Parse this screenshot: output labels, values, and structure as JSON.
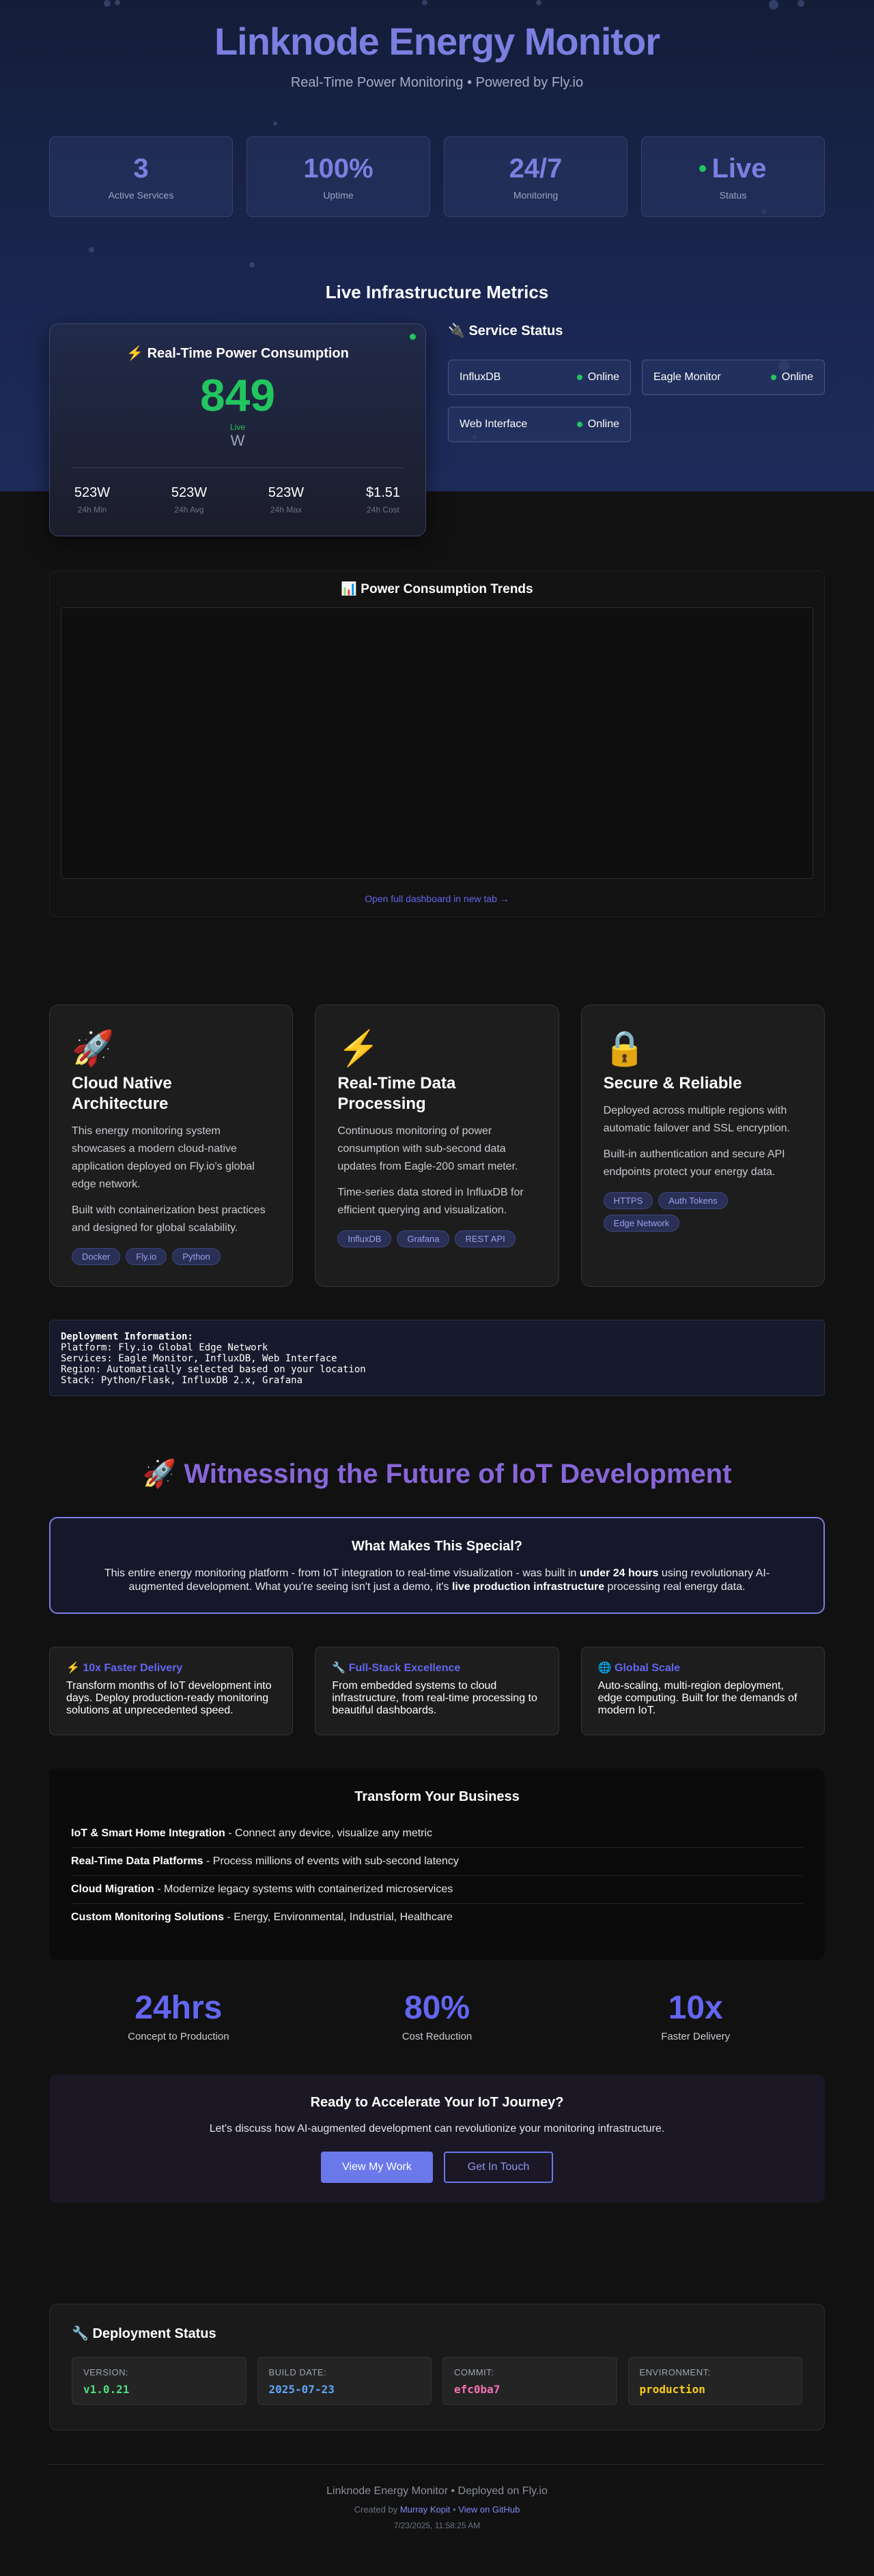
{
  "hero": {
    "title": "Linknode Energy Monitor",
    "subtitle": "Real-Time Power Monitoring • Powered by Fly.io",
    "stats": [
      {
        "value": "3",
        "label": "Active Services"
      },
      {
        "value": "100%",
        "label": "Uptime"
      },
      {
        "value": "24/7",
        "label": "Monitoring"
      },
      {
        "value": "Live",
        "label": "Status"
      }
    ]
  },
  "metrics": {
    "title": "Live Infrastructure Metrics",
    "power": {
      "title": "⚡ Real-Time Power Consumption",
      "value": "849",
      "live_label": "Live",
      "unit": "W",
      "stats": [
        {
          "value": "523W",
          "label": "24h Min"
        },
        {
          "value": "523W",
          "label": "24h Avg"
        },
        {
          "value": "523W",
          "label": "24h Max"
        },
        {
          "value": "$1.51",
          "label": "24h Cost"
        }
      ]
    },
    "services": {
      "title": "🔌 Service Status",
      "items": [
        {
          "name": "InfluxDB",
          "status": "Online"
        },
        {
          "name": "Eagle Monitor",
          "status": "Online"
        },
        {
          "name": "Web Interface",
          "status": "Online"
        }
      ]
    }
  },
  "trends": {
    "title": "📊 Power Consumption Trends",
    "link": "Open full dashboard in new tab →"
  },
  "features": [
    {
      "icon": "🚀",
      "title": "Cloud Native Architecture",
      "paragraphs": [
        "This energy monitoring system showcases a modern cloud-native application deployed on Fly.io's global edge network.",
        "Built with containerization best practices and designed for global scalability."
      ],
      "tags": [
        "Docker",
        "Fly.io",
        "Python"
      ]
    },
    {
      "icon": "⚡",
      "title": "Real-Time Data Processing",
      "paragraphs": [
        "Continuous monitoring of power consumption with sub-second data updates from Eagle-200 smart meter.",
        "Time-series data stored in InfluxDB for efficient querying and visualization."
      ],
      "tags": [
        "InfluxDB",
        "Grafana",
        "REST API"
      ]
    },
    {
      "icon": "🔒",
      "title": "Secure & Reliable",
      "paragraphs": [
        "Deployed across multiple regions with automatic failover and SSL encryption.",
        "Built-in authentication and secure API endpoints protect your energy data."
      ],
      "tags": [
        "HTTPS",
        "Auth Tokens",
        "Edge Network"
      ]
    }
  ],
  "deployment_info": {
    "heading": "Deployment Information:",
    "lines": [
      "Platform: Fly.io Global Edge Network",
      "Services: Eagle Monitor, InfluxDB, Web Interface",
      "Region: Automatically selected based on your location",
      "Stack: Python/Flask, InfluxDB 2.x, Grafana"
    ]
  },
  "future": {
    "title": "🚀 Witnessing the Future of IoT Development",
    "special_title": "What Makes This Special?",
    "special_pre": "This entire energy monitoring platform - from IoT integration to real-time visualization - was built in ",
    "special_b1": "under 24 hours",
    "special_mid": " using revolutionary AI-augmented development. What you're seeing isn't just a demo, it's ",
    "special_b2": "live production infrastructure",
    "special_post": " processing real energy data."
  },
  "mini_cards": [
    {
      "title": "⚡ 10x Faster Delivery",
      "text": "Transform months of IoT development into days. Deploy production-ready monitoring solutions at unprecedented speed."
    },
    {
      "title": "🔧 Full-Stack Excellence",
      "text": "From embedded systems to cloud infrastructure, from real-time processing to beautiful dashboards."
    },
    {
      "title": "🌐 Global Scale",
      "text": "Auto-scaling, multi-region deployment, edge computing. Built for the demands of modern IoT."
    }
  ],
  "business": {
    "title": "Transform Your Business",
    "items": [
      {
        "bold": "IoT & Smart Home Integration",
        "text": " - Connect any device, visualize any metric"
      },
      {
        "bold": "Real-Time Data Platforms",
        "text": " - Process millions of events with sub-second latency"
      },
      {
        "bold": "Cloud Migration",
        "text": " - Modernize legacy systems with containerized microservices"
      },
      {
        "bold": "Custom Monitoring Solutions",
        "text": " - Energy, Environmental, Industrial, Healthcare"
      }
    ]
  },
  "big_stats": [
    {
      "value": "24hrs",
      "label": "Concept to Production"
    },
    {
      "value": "80%",
      "label": "Cost Reduction"
    },
    {
      "value": "10x",
      "label": "Faster Delivery"
    }
  ],
  "cta": {
    "title": "Ready to Accelerate Your IoT Journey?",
    "text": "Let's discuss how AI-augmented development can revolutionize your monitoring infrastructure.",
    "primary": "View My Work",
    "secondary": "Get In Touch"
  },
  "deploy_status": {
    "title": "🔧 Deployment Status",
    "cells": [
      {
        "label": "VERSION:",
        "value": "v1.0.21",
        "color": "#4ade80"
      },
      {
        "label": "BUILD DATE:",
        "value": "2025-07-23",
        "color": "#60a5fa"
      },
      {
        "label": "COMMIT:",
        "value": "efc0ba7",
        "color": "#f472b6"
      },
      {
        "label": "ENVIRONMENT:",
        "value": "production",
        "color": "#facc15"
      }
    ]
  },
  "footer": {
    "line1": "Linknode Energy Monitor • Deployed on Fly.io",
    "created_by": "Created by ",
    "author": "Murray Kopit",
    "sep": " • ",
    "github": "View on GitHub",
    "timestamp": "7/23/2025, 11:58:25 AM"
  },
  "colors": {
    "accent": "#6366f1",
    "live_green": "#22c55e",
    "title_purple": "#7c7fe0"
  }
}
